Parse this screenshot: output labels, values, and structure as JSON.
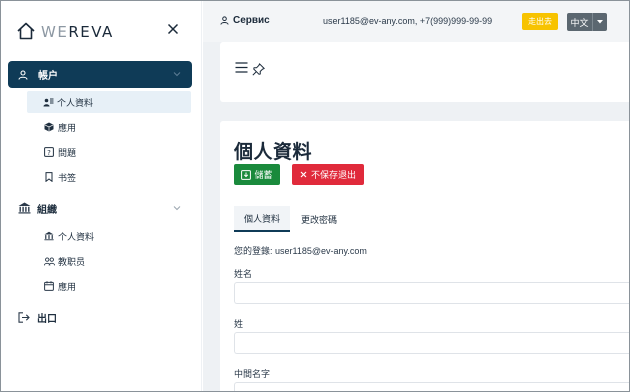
{
  "brand": {
    "name_prefix": "WE",
    "name_suffix": "REVA",
    "icons": {
      "logo": "house-outline-icon",
      "close": "close-icon"
    }
  },
  "sidebar": {
    "account": {
      "label": "帳户",
      "icon": "user-icon",
      "expanded": true,
      "items": [
        {
          "label": "个人資料",
          "icon": "users-icon",
          "active": true
        },
        {
          "label": "應用",
          "icon": "cube-icon"
        },
        {
          "label": "問題",
          "icon": "question-box-icon"
        },
        {
          "label": "书签",
          "icon": "bookmark-icon"
        }
      ]
    },
    "org": {
      "label": "組織",
      "icon": "bank-icon",
      "expanded": true,
      "items": [
        {
          "label": "个人資料",
          "icon": "bank-icon"
        },
        {
          "label": "教职员",
          "icon": "people-icon"
        },
        {
          "label": "應用",
          "icon": "calendar-icon"
        }
      ]
    },
    "exit": {
      "label": "出口",
      "icon": "sign-out-icon"
    }
  },
  "topbar": {
    "service_label": "Сервис",
    "user_info": "user1185@ev-any.com, +7(999)999-99-99",
    "logout_label": "走出去",
    "language": "中文"
  },
  "toolbar": {
    "icons": {
      "menu": "hamburger-menu-icon",
      "pin": "pin-icon"
    }
  },
  "profile": {
    "title": "個人資料",
    "save_label": "儲蓄",
    "exit_label": "不保存退出",
    "tabs": [
      {
        "label": "個人資料",
        "active": true
      },
      {
        "label": "更改密碼",
        "active": false
      }
    ],
    "login_text": "您的登錄: user1185@ev-any.com",
    "fields": [
      {
        "label": "姓名",
        "value": ""
      },
      {
        "label": "姓",
        "value": ""
      },
      {
        "label": "中間名字",
        "value": ""
      }
    ]
  },
  "colors": {
    "sidebar_active_bg": "#0f3b57",
    "sub_active_bg": "#e7f0f7",
    "save_button": "#1a8a3c",
    "exit_button": "#e02a3b",
    "logout_button": "#f7c300",
    "language_button": "#5b6770",
    "main_bg": "#eef1f4"
  }
}
